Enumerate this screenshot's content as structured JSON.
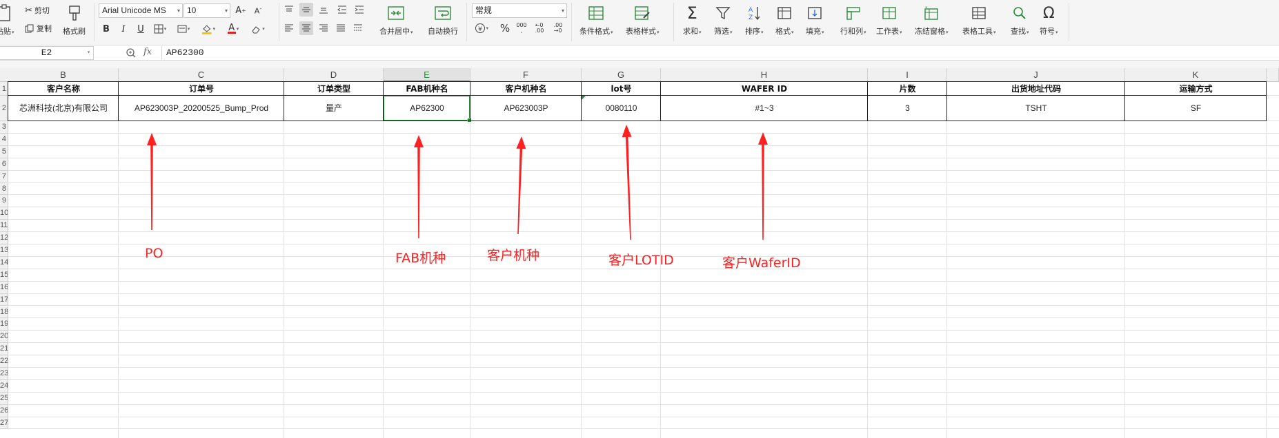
{
  "ribbon": {
    "paste_label": "粘贴",
    "cut_label": "剪切",
    "copy_label": "复制",
    "format_painter_label": "格式刷",
    "font_name": "Arial Unicode MS",
    "font_size": "10",
    "bold": "B",
    "italic": "I",
    "underline": "U",
    "font_color": "A",
    "merge_label": "合并居中",
    "wrap_label": "自动换行",
    "number_format": "常规",
    "percent": "%",
    "thousands": "000",
    "dec_inc": "+0 .00",
    "dec_dec": ".00 →0",
    "cond_format_label": "条件格式",
    "table_style_label": "表格样式",
    "sum_label": "求和",
    "filter_label": "筛选",
    "sort_label": "排序",
    "format_label": "格式",
    "fill_label": "填充",
    "row_col_label": "行和列",
    "worksheet_label": "工作表",
    "freeze_label": "冻结窗格",
    "table_tools_label": "表格工具",
    "find_label": "查找",
    "symbol_label": "符号"
  },
  "formula_bar": {
    "name_box": "E2",
    "fx": "fx",
    "content": "AP62300"
  },
  "sheet": {
    "columns": [
      "B",
      "C",
      "D",
      "E",
      "F",
      "G",
      "H",
      "I",
      "J",
      "K"
    ],
    "selected_column": "E",
    "row_numbers": [
      "1",
      "2",
      "3",
      "4",
      "5",
      "6",
      "7",
      "8",
      "9",
      "10",
      "11",
      "12",
      "13",
      "14",
      "15",
      "16",
      "17",
      "18",
      "19",
      "20",
      "21",
      "22",
      "23",
      "24",
      "25",
      "26",
      "27"
    ],
    "headers": [
      "客户名称",
      "订单号",
      "订单类型",
      "FAB机种名",
      "客户机种名",
      "lot号",
      "WAFER ID",
      "片数",
      "出货地址代码",
      "运输方式"
    ],
    "row": [
      "芯洲科技(北京)有限公司",
      "AP623003P_20200525_Bump_Prod",
      "量产",
      "AP62300",
      "AP623003P",
      "0080110",
      "#1~3",
      "3",
      "TSHT",
      "SF"
    ],
    "selected_cell": "E2"
  },
  "annotations": {
    "po": "PO",
    "fab": "FAB机种",
    "customer_model": "客户机种",
    "customer_lot": "客户LOTID",
    "customer_wafer": "客户WaferID",
    "color": "#ff2020"
  },
  "colors": {
    "selection": "#2e8b3d",
    "ribbon_bg": "#f5f5f5",
    "grid": "#e1e1e1"
  }
}
